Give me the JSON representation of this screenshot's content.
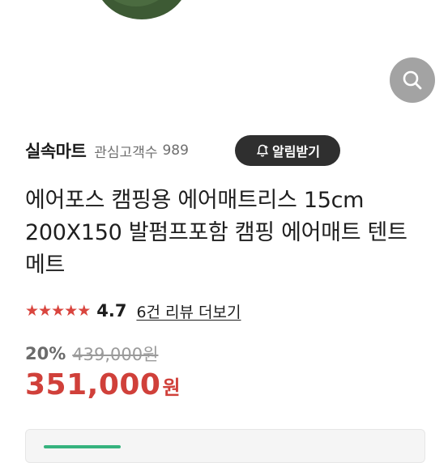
{
  "colors": {
    "accent_red": "#d0403a",
    "star_red": "#d9453e",
    "alarm_button_bg": "#2f2f2f",
    "zoom_button_bg": "#a3a3a3",
    "product_green": "#3d5a34"
  },
  "icons": {
    "zoom": "magnifier-icon",
    "alarm": "bell-plus-icon",
    "star": "star-icon"
  },
  "seller": {
    "name": "실속마트",
    "follower_label": "관심고객수",
    "follower_count": "989",
    "alarm_button_label": "알림받기"
  },
  "product": {
    "title": "에어포스 캠핑용 에어매트리스 15cm 200X150 발펌프포함 캠핑 에어매트 텐트 메트"
  },
  "rating": {
    "stars_filled": 4.7,
    "stars_total": 5,
    "value": "4.7",
    "review_link": "6건 리뷰 더보기"
  },
  "price": {
    "discount": "20%",
    "original": "439,000원",
    "sale": "351,000",
    "sale_unit": "원"
  }
}
